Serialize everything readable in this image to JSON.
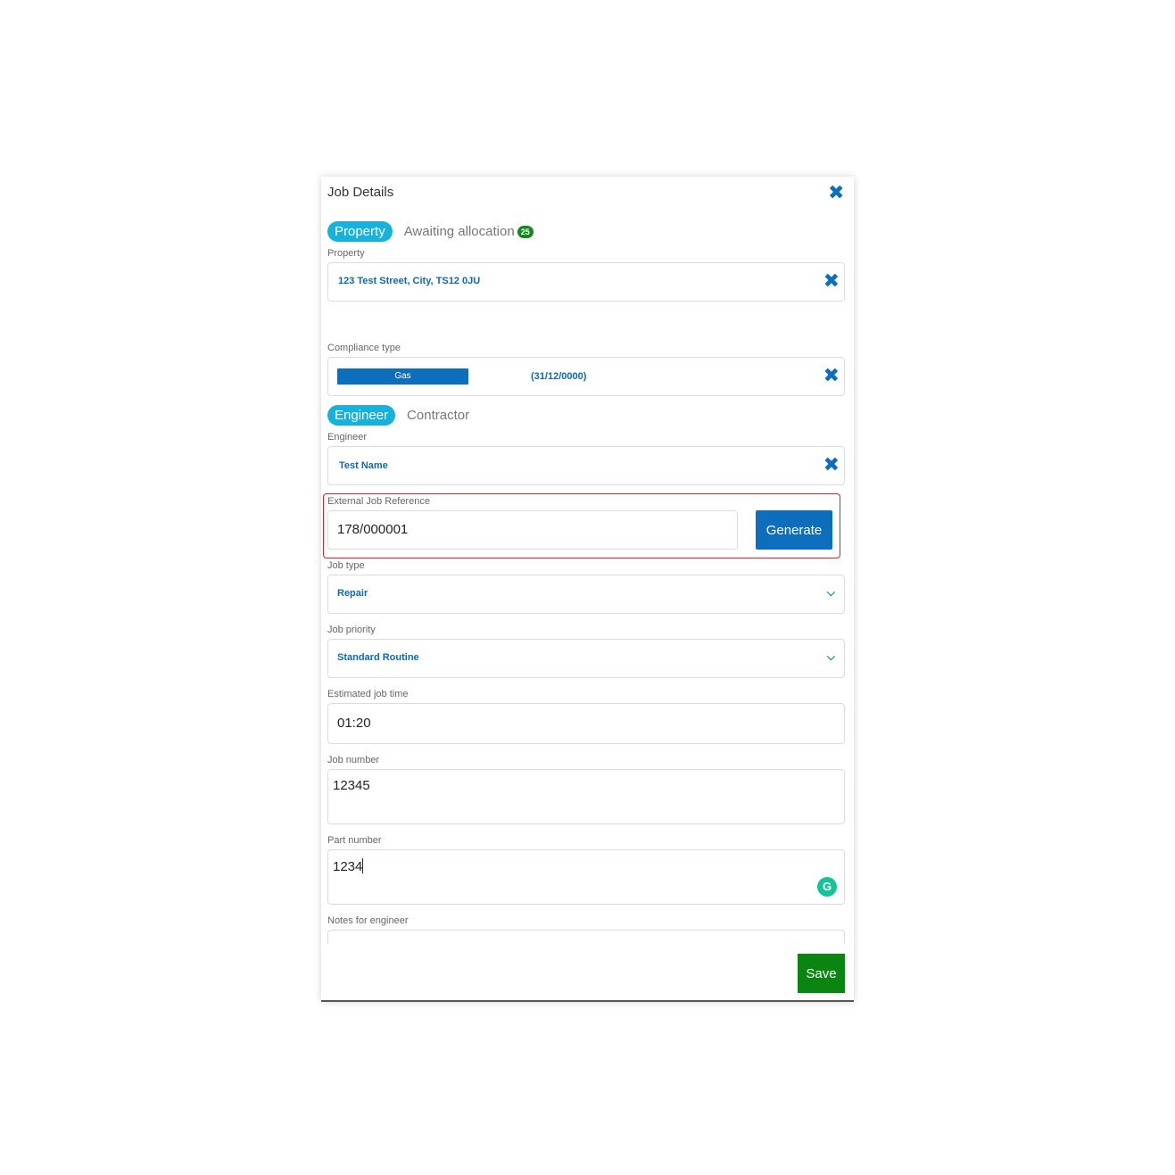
{
  "dialog": {
    "title": "Job Details",
    "close_icon": "close-icon"
  },
  "property_tabs": {
    "active": "Property",
    "inactive": "Awaiting allocation",
    "badge_count": "25"
  },
  "property": {
    "label": "Property",
    "value": "123 Test Street, City, TS12 0JU"
  },
  "compliance": {
    "label": "Compliance type",
    "type": "Gas",
    "date": "(31/12/0000)"
  },
  "assignee_tabs": {
    "active": "Engineer",
    "inactive": "Contractor"
  },
  "engineer": {
    "label": "Engineer",
    "value": "Test Name"
  },
  "external_ref": {
    "label": "External Job Reference",
    "value": "178/000001",
    "generate_label": "Generate"
  },
  "job_type": {
    "label": "Job type",
    "value": "Repair"
  },
  "job_priority": {
    "label": "Job priority",
    "value": "Standard Routine"
  },
  "estimated_time": {
    "label": "Estimated job time",
    "value": "01:20"
  },
  "job_number": {
    "label": "Job number",
    "value": "12345"
  },
  "part_number": {
    "label": "Part number",
    "value": "1234"
  },
  "notes": {
    "label": "Notes for engineer",
    "value": ""
  },
  "footer": {
    "save_label": "Save"
  },
  "colors": {
    "accent_blue": "#0d6ebd",
    "pill_cyan": "#17b2dc",
    "save_green": "#0a8512",
    "error_red": "#d9232d"
  }
}
